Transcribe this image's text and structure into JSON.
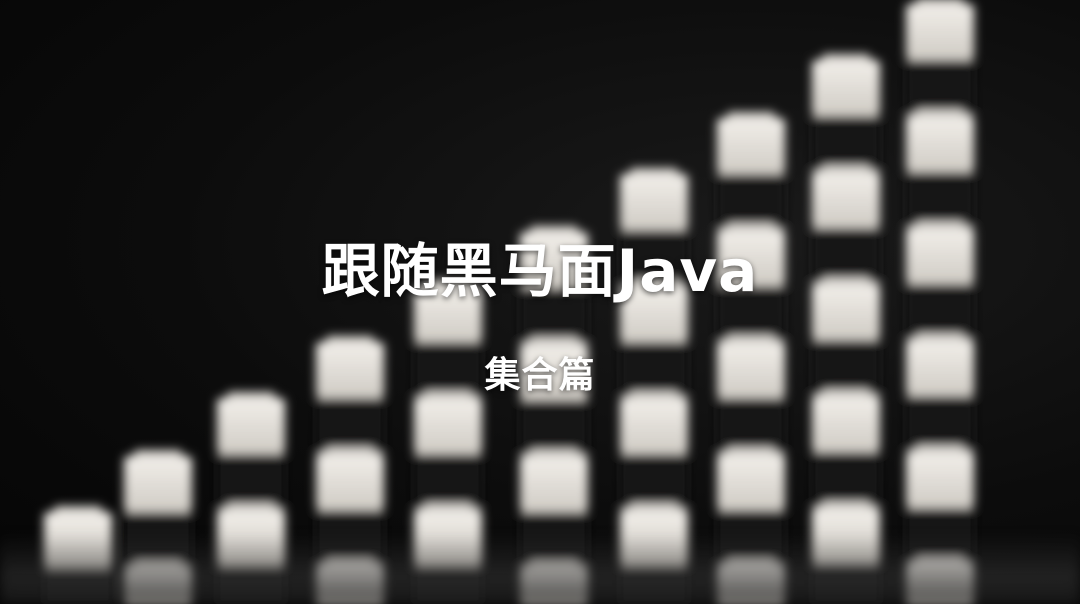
{
  "title": "跟随黑马面Java",
  "subtitle": "集合篇",
  "colors": {
    "background": "#0b0b0b",
    "block_white": "#e6e3dd",
    "block_black": "#141414",
    "text": "#ffffff"
  }
}
